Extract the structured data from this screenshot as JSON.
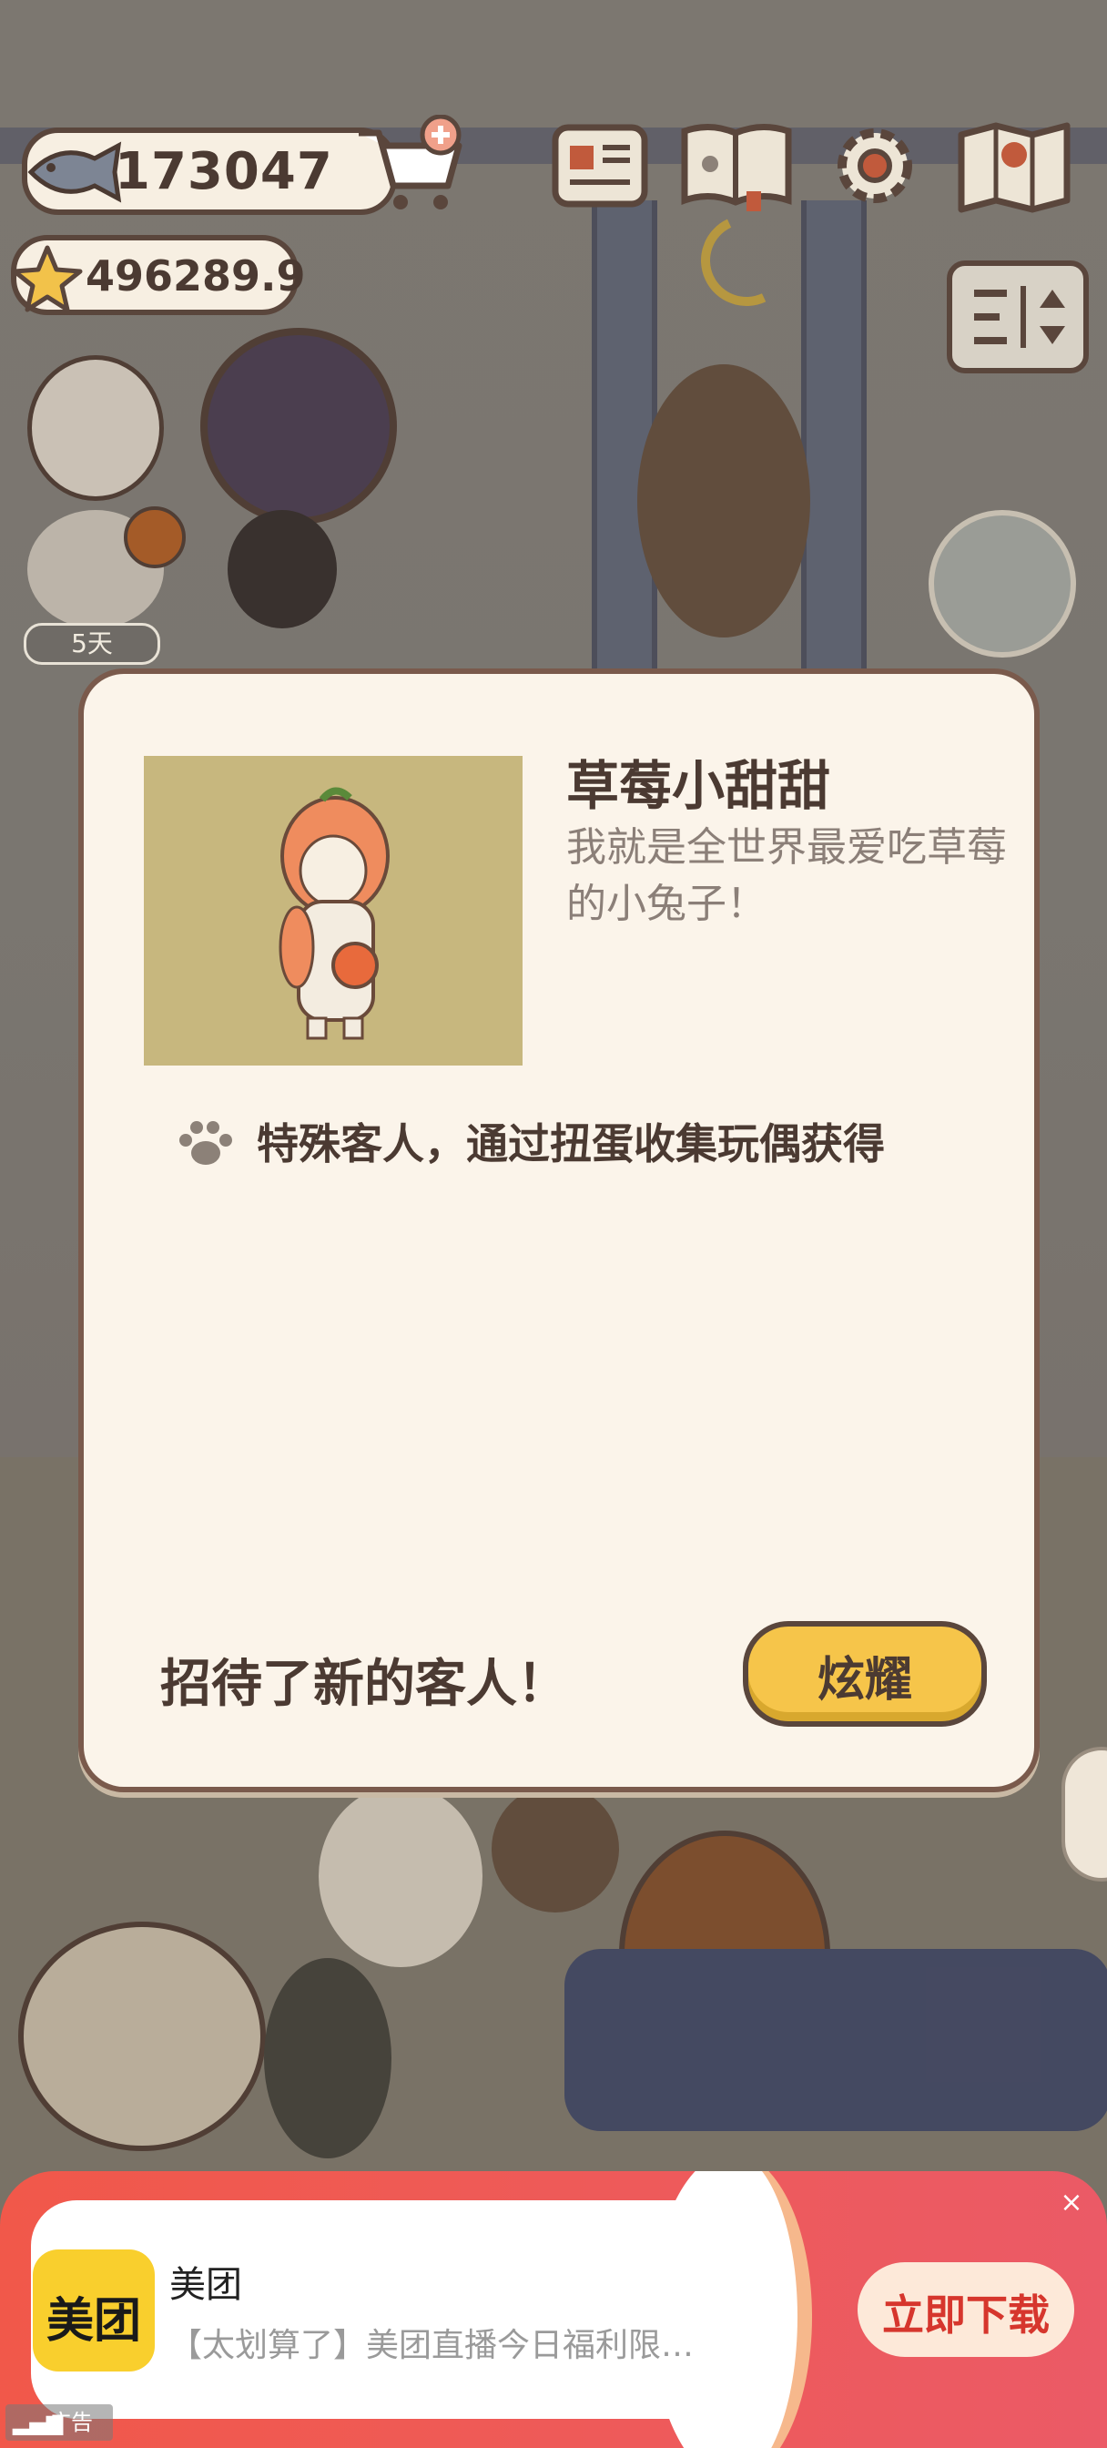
{
  "hud": {
    "fish_count": "173047",
    "star_count": "496289.9",
    "cart_icon": "shopping-cart-plus-icon",
    "top_icons": [
      "newspaper-icon",
      "catalog-book-icon",
      "settings-gear-icon",
      "map-icon"
    ],
    "sort_icon": "sort-toggle-icon",
    "day_badge": "5天"
  },
  "dialog": {
    "customer_name": "草莓小甜甜",
    "customer_desc": "我就是全世界最爱吃草莓的小兔子！",
    "note": "特殊客人，通过扭蛋收集玩偶获得",
    "footer": "招待了新的客人！",
    "show_button": "炫耀",
    "colors": {
      "panel": "#fbf4ea",
      "border": "#7a5a4c",
      "button": "#f6c54a",
      "portrait_bg": "#c7b77e"
    }
  },
  "ad": {
    "brand_logo": "美团",
    "brand_name": "美团",
    "text": "【太划算了】美团直播今日福利限…",
    "cta": "立即下载",
    "tag": "广告",
    "colors": {
      "banner": "#ef5a55",
      "logo": "#f9cf2d",
      "cta_text": "#d6362d"
    }
  }
}
